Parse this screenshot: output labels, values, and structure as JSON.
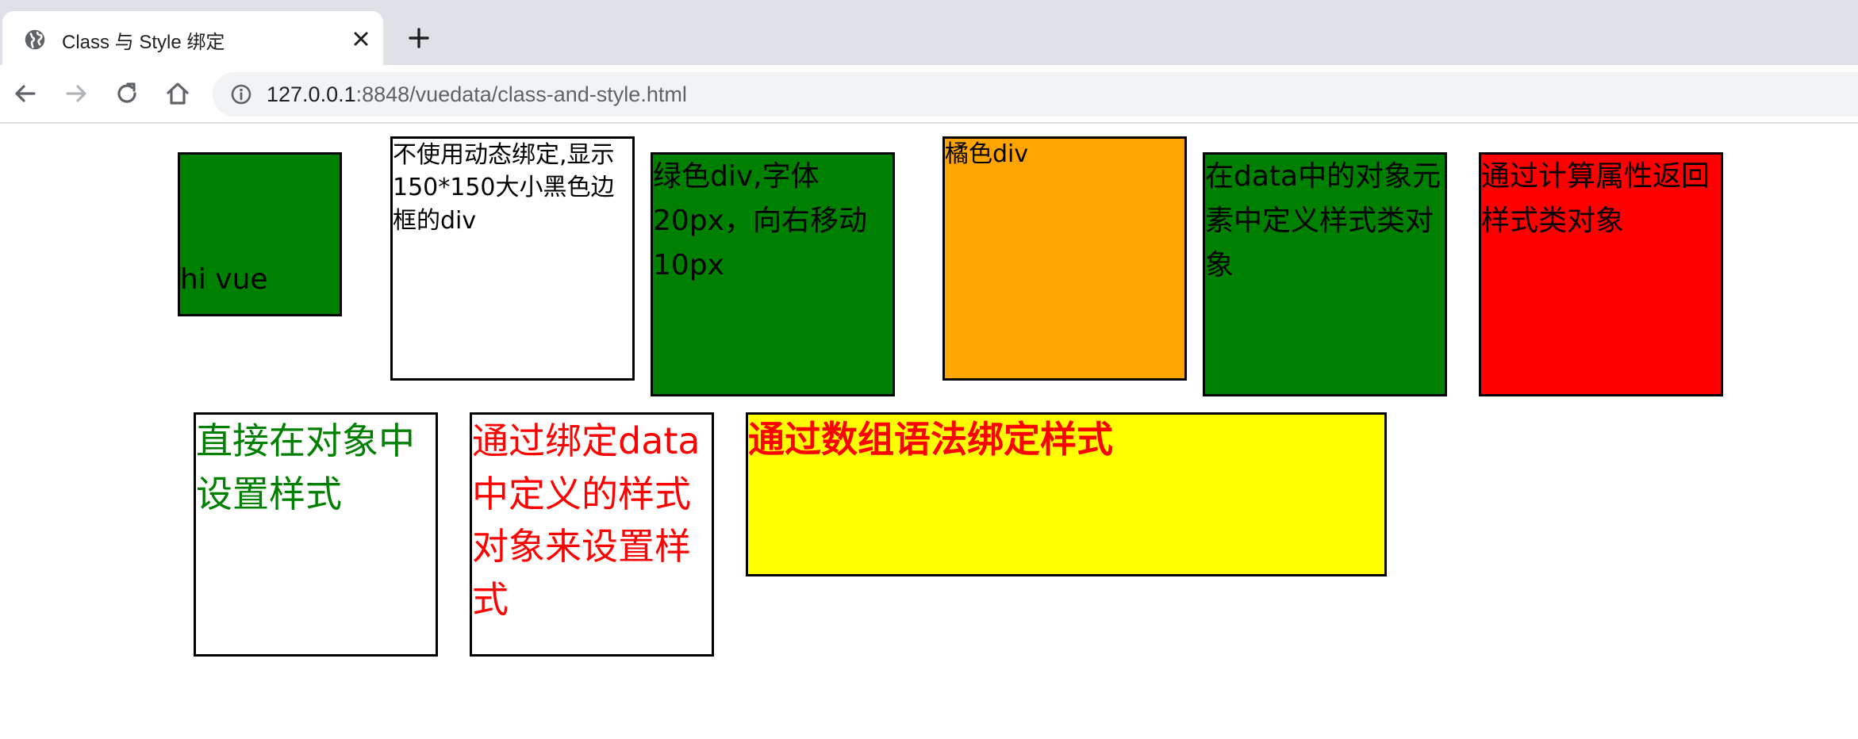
{
  "browser": {
    "tab": {
      "title": "Class 与 Style 绑定",
      "favicon": "globe-icon",
      "close_icon": "close-icon"
    },
    "new_tab_icon": "plus-icon",
    "nav": {
      "back_icon": "arrow-left-icon",
      "forward_icon": "arrow-right-icon",
      "reload_icon": "reload-icon",
      "home_icon": "home-icon"
    },
    "address_bar": {
      "info_icon": "info-icon",
      "host": "127.0.0.1",
      "path": ":8848/vuedata/class-and-style.html"
    }
  },
  "page": {
    "boxes": [
      {
        "text": "hi vue",
        "background": "#008000",
        "text_color": "#000000"
      },
      {
        "text": "不使用动态绑定,显示150*150大小黑色边框的div",
        "background": "#ffffff",
        "text_color": "#000000"
      },
      {
        "text": "绿色div,字体20px，向右移动10px",
        "background": "#008000",
        "text_color": "#000000"
      },
      {
        "text": "橘色div",
        "background": "#ffa500",
        "text_color": "#000000"
      },
      {
        "text": "在data中的对象元素中定义样式类对象",
        "background": "#008000",
        "text_color": "#000000"
      },
      {
        "text": "通过计算属性返回样式类对象",
        "background": "#ff0000",
        "text_color": "#000000"
      },
      {
        "text": "直接在对象中设置样式",
        "background": "#ffffff",
        "text_color": "#008000"
      },
      {
        "text": "通过绑定data中定义的样式对象来设置样式",
        "background": "#ffffff",
        "text_color": "#ff0000"
      },
      {
        "text": "通过数组语法绑定样式",
        "background": "#ffff00",
        "text_color": "#ff0000"
      }
    ]
  }
}
